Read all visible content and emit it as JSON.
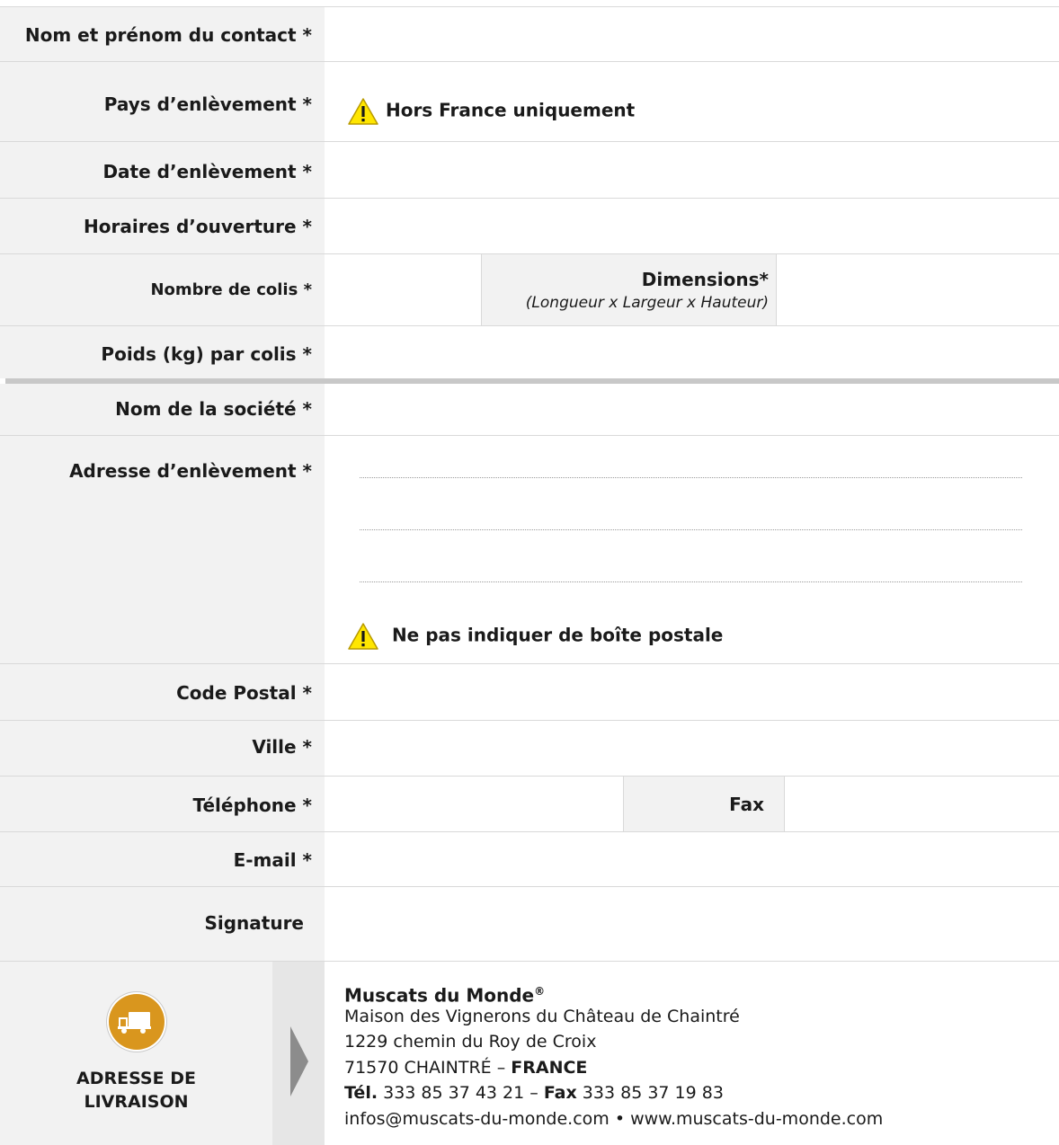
{
  "form": {
    "contact_label": "Nom et prénom du contact *",
    "country_label": "Pays d’enlèvement *",
    "country_note": "Hors France uniquement",
    "date_label": "Date d’enlèvement *",
    "hours_label": "Horaires d’ouverture *",
    "parcels_label": "Nombre de colis *",
    "dimensions_label": "Dimensions*",
    "dimensions_hint": "(Longueur x Largeur x Hauteur)",
    "weight_label": "Poids (kg) par colis *",
    "company_label": "Nom de la société *",
    "address_label": "Adresse d’enlèvement *",
    "address_note": "Ne pas indiquer de boîte postale",
    "postal_label": "Code Postal *",
    "city_label": "Ville *",
    "phone_label": "Téléphone *",
    "fax_label": "Fax",
    "email_label": "E-mail *",
    "signature_label": "Signature"
  },
  "footer": {
    "delivery_label_line1": "ADRESSE DE",
    "delivery_label_line2": "LIVRAISON",
    "company_name": "Muscats du Monde",
    "registered": "®",
    "line1": "Maison des Vignerons du Château de Chaintré",
    "line2": "1229 chemin du Roy de Croix",
    "city": "71570 CHAINTRÉ – ",
    "country": "FRANCE",
    "tel_label": "Tél.",
    "tel_value": " 333 85 37 43 21 – ",
    "fax_label": "Fax",
    "fax_value": " 333 85 37 19 83",
    "contact_line": "infos@muscats-du-monde.com • www.muscats-du-monde.com"
  },
  "colors": {
    "label_bg": "#f2f2f2",
    "warning_yellow": "#ffe600",
    "truck_badge": "#d9961e",
    "arrow": "#8c8c8c"
  },
  "icons": [
    "warning-icon",
    "truck-icon",
    "chevron-right-icon"
  ]
}
